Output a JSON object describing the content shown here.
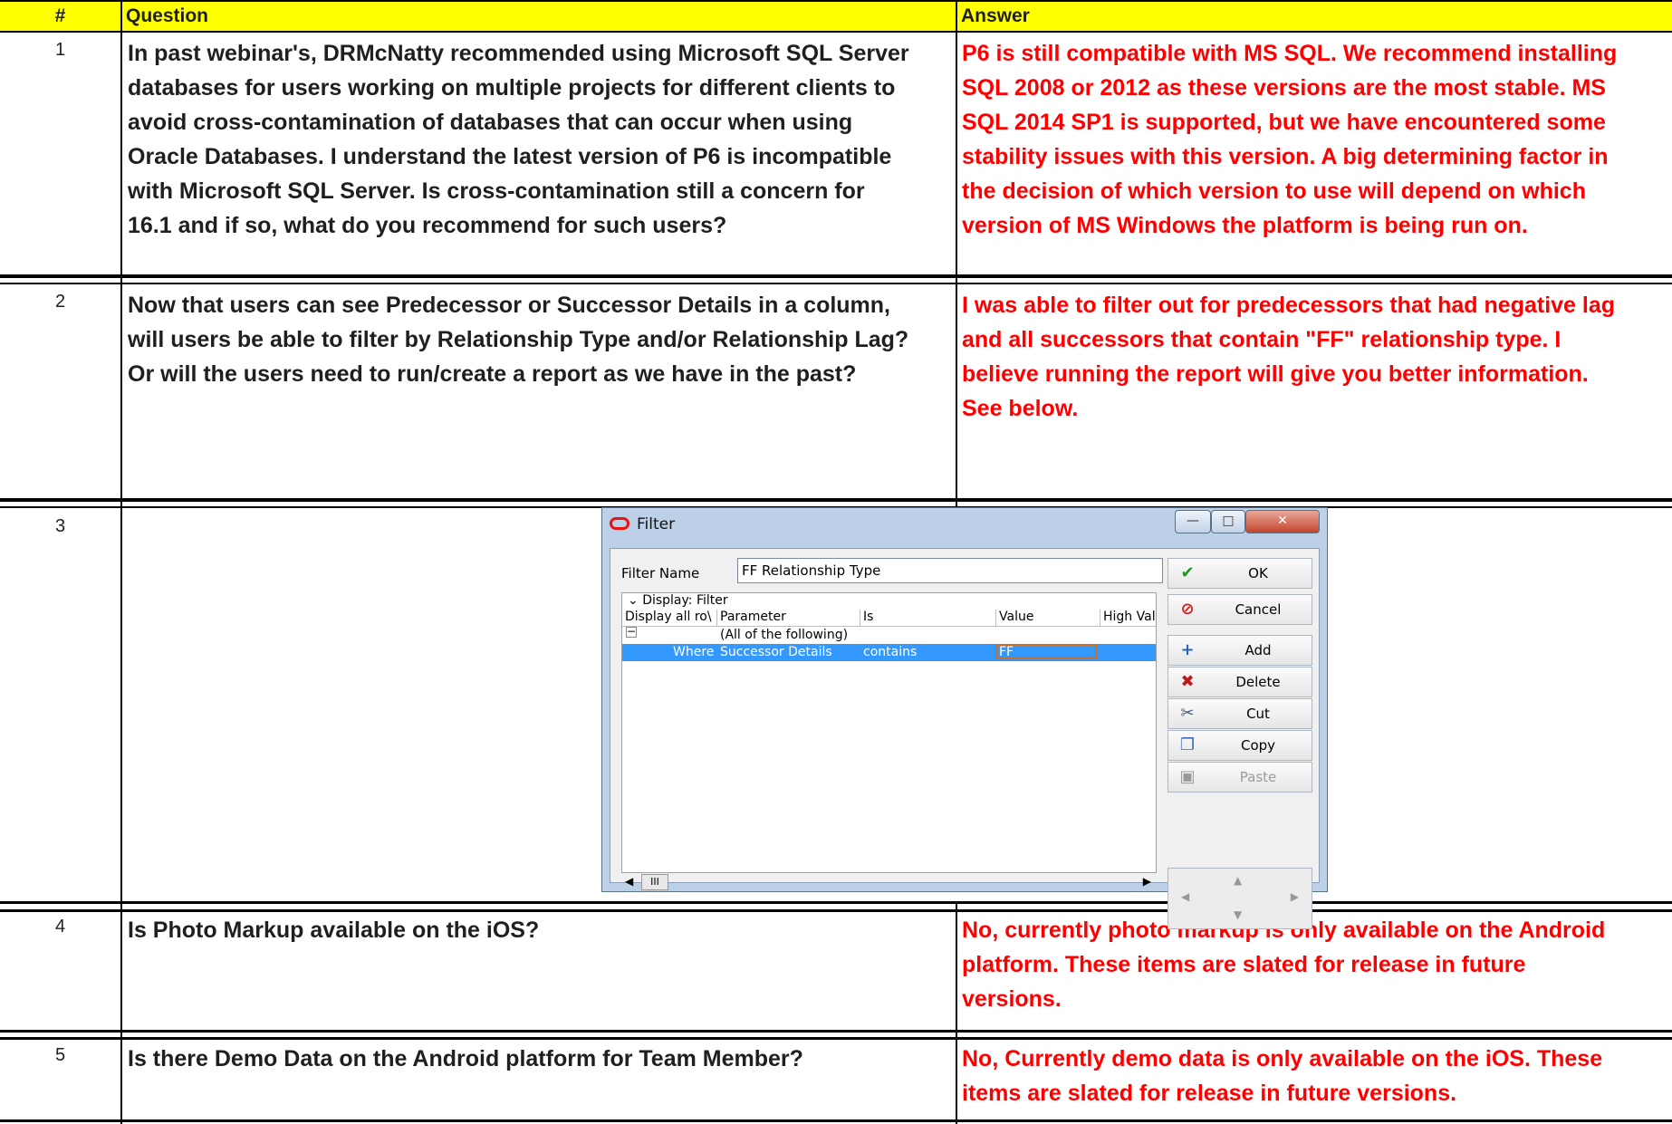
{
  "headers": {
    "num": "#",
    "question": "Question",
    "answer": "Answer"
  },
  "rows": [
    {
      "num": "1",
      "question": [
        "In past webinar's, DRMcNatty recommended using Microsoft SQL Server",
        "databases for users working on multiple projects for different clients to",
        "avoid cross-contamination of databases that can occur when using",
        "Oracle Databases. I understand the latest version of P6 is incompatible",
        "with Microsoft SQL Server. Is cross-contamination still a concern for",
        "16.1 and if so, what do you recommend for such users?"
      ],
      "answer": [
        "P6 is still compatible with MS SQL.  We recommend installing",
        "SQL 2008 or 2012  as these versions are the most stable. MS",
        "SQL 2014 SP1 is supported, but we have encountered some",
        "stability issues with this version. A big determining factor in",
        "the decision of which version to use will depend on which",
        "version of MS Windows the platform is being run on."
      ]
    },
    {
      "num": "2",
      "question": [
        "Now that users can see Predecessor or Successor Details in a column,",
        "will users be able to filter by Relationship Type and/or Relationship Lag?",
        "Or will the users need to run/create a report as we have in the past?"
      ],
      "answer": [
        "I was able to filter out for predecessors  that had negative lag",
        "and all successors that contain \"FF\" relationship type.  I",
        "believe running the report will give you better information.",
        "See below."
      ]
    },
    {
      "num": "3",
      "question": [],
      "answer": []
    },
    {
      "num": "4",
      "question": [
        "Is Photo Markup available on the iOS?"
      ],
      "answer": [
        "No, currently photo markup is only available on the Android",
        "platform. These items are slated for release in future",
        "versions."
      ]
    },
    {
      "num": "5",
      "question": [
        "Is there Demo Data on the Android platform for Team Member?"
      ],
      "answer": [
        "No, Currently demo data is only available on the iOS. These",
        "items are slated for release in future versions."
      ]
    }
  ],
  "dialog": {
    "title": "Filter",
    "filter_name_label": "Filter Name",
    "filter_name_value": "FF Relationship Type",
    "group_label": "Display: Filter",
    "columns": [
      "Display all ro\\",
      "Parameter",
      "Is",
      "Value",
      "High Valu"
    ],
    "group_row": "(All of the following)",
    "condition": {
      "where": "Where",
      "parameter": "Successor Details",
      "is": "contains",
      "value": "FF"
    },
    "buttons": [
      {
        "label": "OK",
        "icon": "check-icon",
        "enabled": true
      },
      {
        "label": "Cancel",
        "icon": "cancel-icon",
        "enabled": true
      },
      {
        "label": "Add",
        "icon": "add-icon",
        "enabled": true
      },
      {
        "label": "Delete",
        "icon": "delete-icon",
        "enabled": true
      },
      {
        "label": "Cut",
        "icon": "scissors-icon",
        "enabled": true
      },
      {
        "label": "Copy",
        "icon": "copy-icon",
        "enabled": true
      },
      {
        "label": "Paste",
        "icon": "paste-icon",
        "enabled": false
      }
    ],
    "scroll_thumb": "III"
  },
  "colors": {
    "header_bg": "#ffff00",
    "answer_text": "#ff0000",
    "question_text": "#1f1f1f",
    "selection": "#3399ff"
  }
}
